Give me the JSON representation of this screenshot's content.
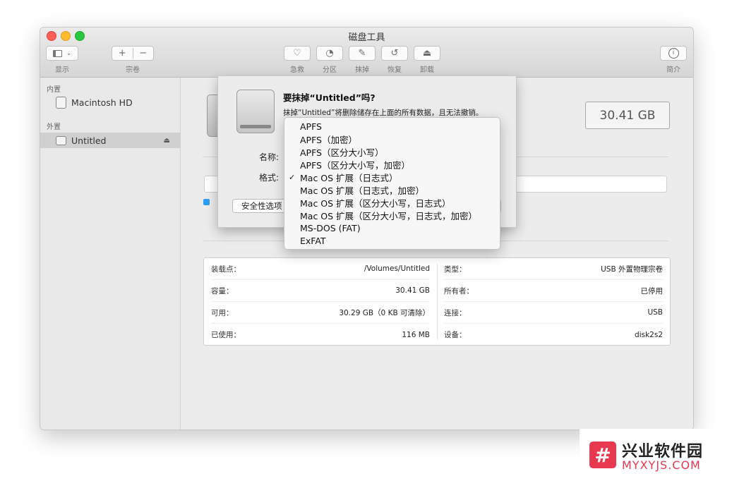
{
  "window": {
    "title": "磁盘工具"
  },
  "toolbar": {
    "view_label": "显示",
    "volume_label": "宗卷",
    "volume_add": "+",
    "volume_remove": "−",
    "firstaid_label": "急救",
    "partition_label": "分区",
    "erase_label": "抹掉",
    "restore_label": "恢复",
    "unmount_label": "卸载",
    "info_label": "简介"
  },
  "sidebar": {
    "internal_header": "内置",
    "internal_items": [
      {
        "label": "Macintosh HD",
        "icon": "internal-disk-icon"
      }
    ],
    "external_header": "外置",
    "external_items": [
      {
        "label": "Untitled",
        "icon": "external-disk-icon",
        "selected": true
      }
    ]
  },
  "main": {
    "capacity": "30.41 GB"
  },
  "sheet": {
    "title": "要抹掉“Untitled”吗?",
    "message": "抹掉“Untitled”将删除储存在上面的所有数据，且无法撤销。",
    "name_label": "名称:",
    "format_label": "格式:",
    "security_button": "安全性选项"
  },
  "format_menu": {
    "selected_index": 4,
    "items": [
      "APFS",
      "APFS（加密）",
      "APFS（区分大小写）",
      "APFS（区分大小写，加密）",
      "Mac OS 扩展（日志式）",
      "Mac OS 扩展（日志式，加密）",
      "Mac OS 扩展（区分大小写，日志式）",
      "Mac OS 扩展（区分大小写，日志式，加密）",
      "MS-DOS (FAT)",
      "ExFAT"
    ]
  },
  "info_table": {
    "left": [
      {
        "key": "装载点：",
        "value": "/Volumes/Untitled"
      },
      {
        "key": "容量：",
        "value": "30.41 GB"
      },
      {
        "key": "可用：",
        "value": "30.29 GB（0 KB 可清除）"
      },
      {
        "key": "已使用：",
        "value": "116 MB"
      }
    ],
    "right": [
      {
        "key": "类型：",
        "value": "USB 外置物理宗卷"
      },
      {
        "key": "所有者：",
        "value": "已停用"
      },
      {
        "key": "连接：",
        "value": "USB"
      },
      {
        "key": "设备：",
        "value": "disk2s2"
      }
    ]
  },
  "watermark": {
    "logo_char": "#",
    "name": "兴业软件园",
    "url": "MYXYJS.COM"
  },
  "colors": {
    "accent": "#2f9cf5",
    "watermark": "#e8384f"
  }
}
